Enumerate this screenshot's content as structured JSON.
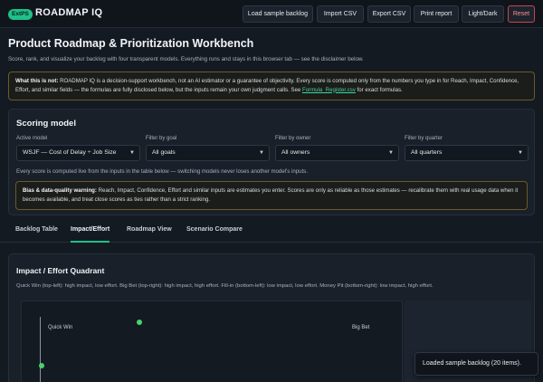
{
  "brand": {
    "badge": "ExtPS",
    "name": "ROADMAP IQ"
  },
  "toolbar": {
    "load_sample": "Load sample backlog",
    "import_csv": "Import CSV",
    "export_csv": "Export CSV",
    "print_report": "Print report",
    "theme_toggle": "Light/Dark",
    "reset": "Reset"
  },
  "header": {
    "title": "Product Roadmap & Prioritization Workbench",
    "subtitle": "Score, rank, and visualize your backlog with four transparent models. Everything runs and stays in this browser tab — see the disclaimer below."
  },
  "disclaimer": {
    "heading": "What this is not:",
    "body": "ROADMAP IQ is a decision-support workbench, not an AI estimator or a guarantee of objectivity. Every score is computed only from the numbers you type in for Reach, Impact, Confidence, Effort, and similar fields — the formulas are fully disclosed below, but the inputs remain your own judgment calls. See",
    "link": "Formula_Register.csv",
    "tail": "for exact formulas."
  },
  "scoring": {
    "title": "Scoring model",
    "active_model_label": "Active model",
    "active_model_value": "WSJF — Cost of Delay ÷ Job Size",
    "goal_label": "Filter by goal",
    "goal_value": "All goals",
    "owner_label": "Filter by owner",
    "owner_value": "All owners",
    "quarter_label": "Filter by quarter",
    "quarter_value": "All quarters",
    "note": "Every score is computed live from the inputs in the table below — switching models never loses another model's inputs.",
    "bias_heading": "Bias & data-quality warning:",
    "bias_body": "Reach, Impact, Confidence, Effort and similar inputs are estimates you enter. Scores are only as reliable as those estimates — recalibrate them with real usage data when it becomes available, and treat close scores as ties rather than a strict ranking."
  },
  "tabs": [
    {
      "label": "Backlog Table",
      "active": false
    },
    {
      "label": "Impact/Effort",
      "active": true
    },
    {
      "label": "Roadmap View",
      "active": false
    },
    {
      "label": "Scenario Compare",
      "active": false
    }
  ],
  "quadrant": {
    "title": "Impact / Effort Quadrant",
    "description": "Quick Win (top-left): high impact, low effort. Big Bet (top-right): high impact, high effort. Fill-in (bottom-left): low impact, low effort. Money Pit (bottom-right): low impact, high effort.",
    "label_quick_win": "Quick Win",
    "label_big_bet": "Big Bet",
    "dot_color": "#49d36b"
  },
  "toast": {
    "message": "Loaded sample backlog (20 items)."
  },
  "colors": {
    "accent": "#1fc08a",
    "background": "#141a22",
    "warning_border": "#6b5a2a",
    "danger": "#c4484f"
  }
}
